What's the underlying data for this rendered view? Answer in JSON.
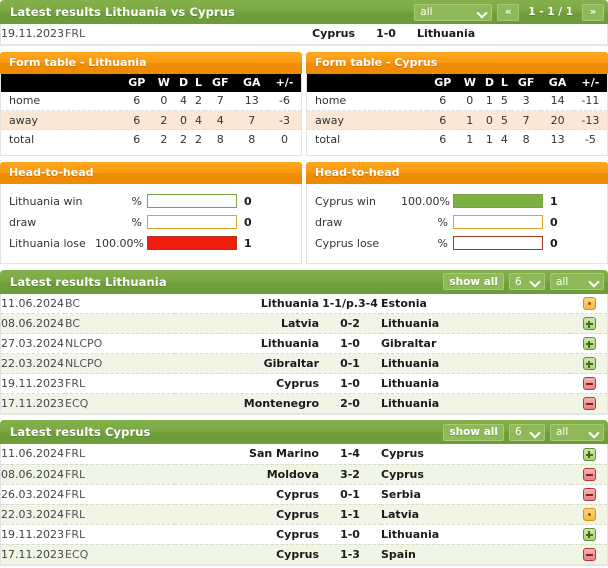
{
  "top_panel": {
    "title": "Latest results Lithuania vs Cyprus",
    "filter_select": "all",
    "prev_label": "«",
    "next_label": "»",
    "page_info": "1 - 1 / 1",
    "rows": [
      {
        "date": "19.11.2023",
        "comp": "FRL",
        "home": "Cyprus",
        "score": "1-0",
        "away": "Lithuania"
      }
    ]
  },
  "form_left": {
    "title": "Form table - Lithuania",
    "headers": [
      "",
      "GP",
      "W",
      "D",
      "L",
      "GF",
      "GA",
      "+/-"
    ],
    "rows": [
      {
        "label": "home",
        "gp": "6",
        "w": "0",
        "d": "4",
        "l": "2",
        "gf": "7",
        "ga": "13",
        "diff": "-6"
      },
      {
        "label": "away",
        "gp": "6",
        "w": "2",
        "d": "0",
        "l": "4",
        "gf": "4",
        "ga": "7",
        "diff": "-3"
      },
      {
        "label": "total",
        "gp": "6",
        "w": "2",
        "d": "2",
        "l": "2",
        "gf": "8",
        "ga": "8",
        "diff": "0"
      }
    ]
  },
  "form_right": {
    "title": "Form table - Cyprus",
    "headers": [
      "",
      "GP",
      "W",
      "D",
      "L",
      "GF",
      "GA",
      "+/-"
    ],
    "rows": [
      {
        "label": "home",
        "gp": "6",
        "w": "0",
        "d": "1",
        "l": "5",
        "gf": "3",
        "ga": "14",
        "diff": "-11"
      },
      {
        "label": "away",
        "gp": "6",
        "w": "1",
        "d": "0",
        "l": "5",
        "gf": "7",
        "ga": "20",
        "diff": "-13"
      },
      {
        "label": "total",
        "gp": "6",
        "w": "1",
        "d": "1",
        "l": "4",
        "gf": "8",
        "ga": "13",
        "diff": "-5"
      }
    ]
  },
  "h2h_left": {
    "title": "Head-to-head",
    "rows": [
      {
        "label": "Lithuania win",
        "pct": "%",
        "fill": 0,
        "count": "0",
        "kind": "win"
      },
      {
        "label": "draw",
        "pct": "%",
        "fill": 0,
        "count": "0",
        "kind": "draw"
      },
      {
        "label": "Lithuania lose",
        "pct": "100.00%",
        "fill": 100,
        "count": "1",
        "kind": "lose"
      }
    ]
  },
  "h2h_right": {
    "title": "Head-to-head",
    "rows": [
      {
        "label": "Cyprus win",
        "pct": "100.00%",
        "fill": 100,
        "count": "1",
        "kind": "win"
      },
      {
        "label": "draw",
        "pct": "%",
        "fill": 0,
        "count": "0",
        "kind": "draw"
      },
      {
        "label": "Cyprus lose",
        "pct": "%",
        "fill": 0,
        "count": "0",
        "kind": "lose"
      }
    ]
  },
  "results_lithuania": {
    "title": "Latest results Lithuania",
    "show_all_label": "show all",
    "count_select": "6",
    "filter_select": "all",
    "rows": [
      {
        "date": "11.06.2024",
        "comp": "BC",
        "home": "Lithuania",
        "score": "1-1/p.3-4",
        "away": "Estonia",
        "status": "draw"
      },
      {
        "date": "08.06.2024",
        "comp": "BC",
        "home": "Latvia",
        "score": "0-2",
        "away": "Lithuania",
        "status": "win"
      },
      {
        "date": "27.03.2024",
        "comp": "NLCPO",
        "home": "Lithuania",
        "score": "1-0",
        "away": "Gibraltar",
        "status": "win"
      },
      {
        "date": "22.03.2024",
        "comp": "NLCPO",
        "home": "Gibraltar",
        "score": "0-1",
        "away": "Lithuania",
        "status": "win"
      },
      {
        "date": "19.11.2023",
        "comp": "FRL",
        "home": "Cyprus",
        "score": "1-0",
        "away": "Lithuania",
        "status": "lose"
      },
      {
        "date": "17.11.2023",
        "comp": "ECQ",
        "home": "Montenegro",
        "score": "2-0",
        "away": "Lithuania",
        "status": "lose"
      }
    ]
  },
  "results_cyprus": {
    "title": "Latest results Cyprus",
    "show_all_label": "show all",
    "count_select": "6",
    "filter_select": "all",
    "rows": [
      {
        "date": "11.06.2024",
        "comp": "FRL",
        "home": "San Marino",
        "score": "1-4",
        "away": "Cyprus",
        "status": "win"
      },
      {
        "date": "08.06.2024",
        "comp": "FRL",
        "home": "Moldova",
        "score": "3-2",
        "away": "Cyprus",
        "status": "lose"
      },
      {
        "date": "26.03.2024",
        "comp": "FRL",
        "home": "Cyprus",
        "score": "0-1",
        "away": "Serbia",
        "status": "lose"
      },
      {
        "date": "22.03.2024",
        "comp": "FRL",
        "home": "Cyprus",
        "score": "1-1",
        "away": "Latvia",
        "status": "draw"
      },
      {
        "date": "19.11.2023",
        "comp": "FRL",
        "home": "Cyprus",
        "score": "1-0",
        "away": "Lithuania",
        "status": "win"
      },
      {
        "date": "17.11.2023",
        "comp": "ECQ",
        "home": "Cyprus",
        "score": "1-3",
        "away": "Spain",
        "status": "lose"
      }
    ]
  },
  "colors": {
    "green": "#7aa943",
    "orange": "#f99810",
    "win": "#7db042",
    "draw": "#f2a31e",
    "lose": "#f01c0d"
  }
}
